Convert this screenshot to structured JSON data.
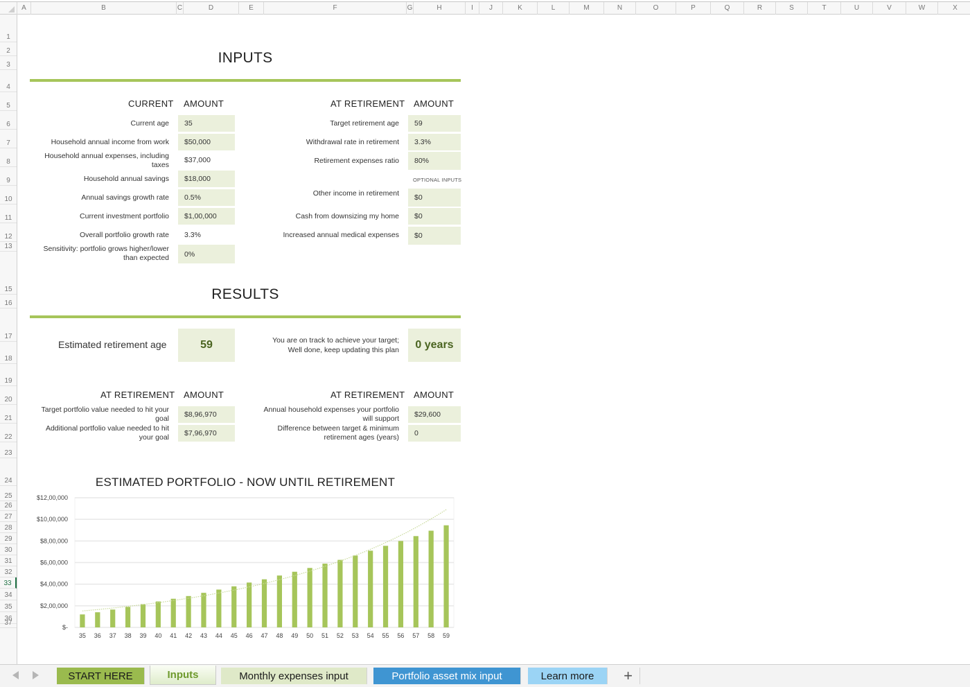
{
  "spreadsheet": {
    "columns": [
      "A",
      "B",
      "C",
      "D",
      "E",
      "F",
      "G",
      "H",
      "I",
      "J",
      "K",
      "L",
      "M",
      "N",
      "O",
      "P",
      "Q",
      "R",
      "S",
      "T",
      "U",
      "V",
      "W",
      "X"
    ],
    "rows": [
      "1",
      "2",
      "3",
      "4",
      "5",
      "6",
      "7",
      "8",
      "9",
      "10",
      "11",
      "12",
      "13",
      "15",
      "16",
      "17",
      "18",
      "19",
      "20",
      "21",
      "22",
      "23",
      "24",
      "25",
      "26",
      "27",
      "28",
      "29",
      "30",
      "31",
      "32",
      "33",
      "34",
      "35",
      "36",
      "37"
    ],
    "active_row": "33"
  },
  "inputs": {
    "title": "INPUTS",
    "current": {
      "header": "CURRENT",
      "amount_header": "AMOUNT",
      "items": [
        {
          "label": "Current age",
          "value": "35",
          "shaded": true
        },
        {
          "label": "Household annual income from work",
          "value": "$50,000",
          "shaded": true
        },
        {
          "label": "Household annual expenses, including taxes",
          "value": "$37,000",
          "shaded": false
        },
        {
          "label": "Household annual savings",
          "value": "$18,000",
          "shaded": true
        },
        {
          "label": "Annual savings growth rate",
          "value": "0.5%",
          "shaded": true
        },
        {
          "label": "Current investment portfolio",
          "value": "$1,00,000",
          "shaded": true
        },
        {
          "label": "Overall portfolio growth rate",
          "value": "3.3%",
          "shaded": false
        },
        {
          "label": "Sensitivity: portfolio grows higher/lower than expected",
          "value": "0%",
          "shaded": true
        }
      ]
    },
    "retirement": {
      "header": "AT RETIREMENT",
      "amount_header": "AMOUNT",
      "items": [
        {
          "label": "Target retirement age",
          "value": "59"
        },
        {
          "label": "Withdrawal rate in retirement",
          "value": "3.3%"
        },
        {
          "label": "Retirement expenses ratio",
          "value": "80%"
        }
      ],
      "optional_label": "OPTIONAL INPUTS",
      "optional_items": [
        {
          "label": "Other income in retirement",
          "value": "$0"
        },
        {
          "label": "Cash from downsizing my home",
          "value": "$0"
        },
        {
          "label": "Increased annual medical expenses",
          "value": "$0"
        }
      ]
    }
  },
  "results": {
    "title": "RESULTS",
    "estimated_age_label": "Estimated retirement age",
    "estimated_age_value": "59",
    "track_message_line1": "You are on track to achieve your target;",
    "track_message_line2": "Well done, keep updating this plan",
    "track_value": "0 years",
    "left": {
      "header": "AT RETIREMENT",
      "amount_header": "AMOUNT",
      "items": [
        {
          "label": "Target portfolio value needed to hit your goal",
          "value": "$8,96,970"
        },
        {
          "label": "Additional portfolio value needed to hit your goal",
          "value": "$7,96,970"
        }
      ]
    },
    "right": {
      "header": "AT RETIREMENT",
      "amount_header": "AMOUNT",
      "items": [
        {
          "label": "Annual household expenses your portfolio will support",
          "value": "$29,600"
        },
        {
          "label": "Difference between target & minimum retirement ages (years)",
          "value": "0"
        }
      ]
    }
  },
  "chart_data": {
    "type": "bar",
    "title": "ESTIMATED PORTFOLIO - NOW UNTIL RETIREMENT",
    "xlabel": "",
    "ylabel": "",
    "categories": [
      "35",
      "36",
      "37",
      "38",
      "39",
      "40",
      "41",
      "42",
      "43",
      "44",
      "45",
      "46",
      "47",
      "48",
      "49",
      "50",
      "51",
      "52",
      "53",
      "54",
      "55",
      "56",
      "57",
      "58",
      "59"
    ],
    "series": [
      {
        "name": "Estimated portfolio",
        "type": "bar",
        "color": "#a6c55a",
        "values": [
          120000,
          140000,
          165000,
          190000,
          215000,
          240000,
          265000,
          290000,
          320000,
          350000,
          380000,
          415000,
          445000,
          480000,
          515000,
          550000,
          590000,
          625000,
          665000,
          710000,
          755000,
          800000,
          845000,
          895000,
          945000
        ]
      },
      {
        "name": "Trendline",
        "type": "line",
        "style": "dotted",
        "color": "#c8d99a",
        "values": [
          152000,
          162000,
          173000,
          185000,
          198000,
          212000,
          227000,
          243000,
          260000,
          279000,
          299000,
          320000,
          343000,
          368000,
          394000,
          423000,
          453000,
          486000,
          521000,
          559000,
          600000,
          644000,
          691000,
          741000,
          1090000
        ]
      }
    ],
    "ylim": [
      0,
      1200000
    ],
    "yticks": [
      {
        "value": 0,
        "label": "$-"
      },
      {
        "value": 200000,
        "label": "$2,00,000"
      },
      {
        "value": 400000,
        "label": "$4,00,000"
      },
      {
        "value": 600000,
        "label": "$6,00,000"
      },
      {
        "value": 800000,
        "label": "$8,00,000"
      },
      {
        "value": 1000000,
        "label": "$10,00,000"
      },
      {
        "value": 1200000,
        "label": "$12,00,000"
      }
    ],
    "grid": true,
    "legend": "none"
  },
  "tabs": [
    {
      "label": "START HERE",
      "active": false
    },
    {
      "label": "Inputs",
      "active": true
    },
    {
      "label": "Monthly expenses input",
      "active": false
    },
    {
      "label": "Portfolio asset mix input",
      "active": false
    },
    {
      "label": "Learn more",
      "active": false
    }
  ],
  "add_sheet_label": "+",
  "colors": {
    "accent_green": "#a6c55a",
    "input_fill": "#ebf0dc",
    "result_text": "#4a6420",
    "tab_blue": "#3f95d2",
    "tab_light_blue": "#9bd4f5"
  }
}
